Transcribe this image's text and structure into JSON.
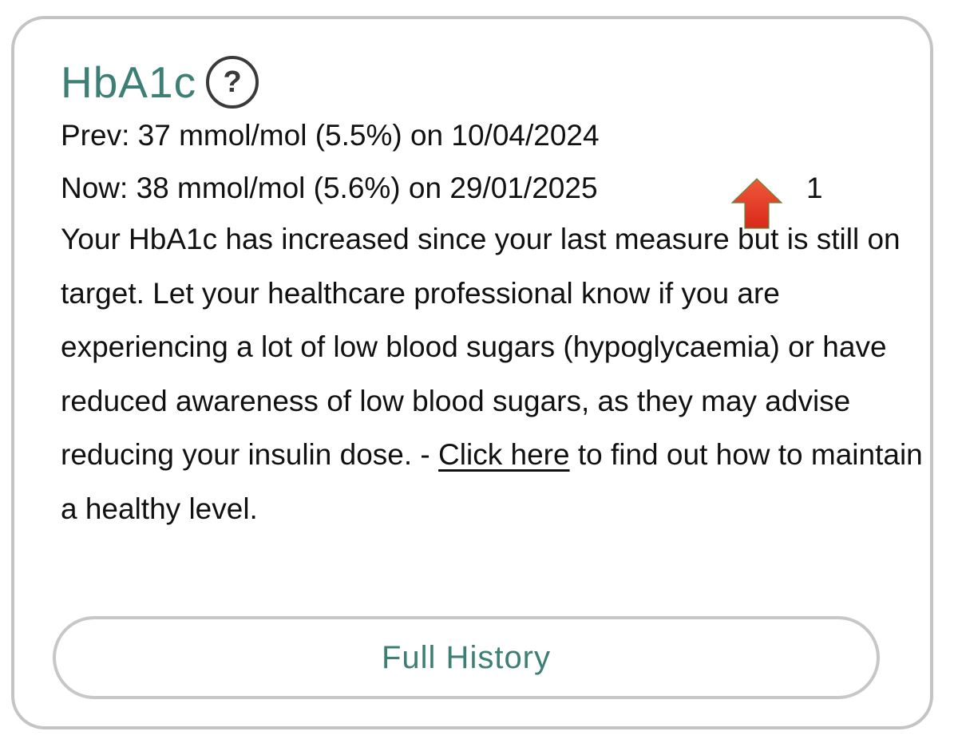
{
  "card": {
    "title": "HbA1c",
    "help_icon": {
      "name": "help-icon",
      "glyph": "?"
    },
    "previous": {
      "label": "Prev:",
      "text": "37 mmol/mol (5.5%) on 10/04/2024"
    },
    "current": {
      "label": "Now:",
      "text": "38 mmol/mol (5.6%) on 29/01/2025",
      "trend_icon": "arrow-up-icon",
      "change": "1"
    },
    "message": {
      "before_link": "Your HbA1c has increased since your last measure but is still on target. Let your healthcare professional know if you are experiencing a lot of low blood sugars (hypoglycaemia) or have reduced awareness of low blood sugars, as they may advise reducing your insulin dose. - ",
      "link_text": "Click here",
      "after_link": " to find out how to maintain a healthy level."
    },
    "history_button": "Full History"
  },
  "colors": {
    "accent": "#3d7f74",
    "trend_up": "#e63b22",
    "border": "#c4c4c4",
    "text": "#111111"
  }
}
